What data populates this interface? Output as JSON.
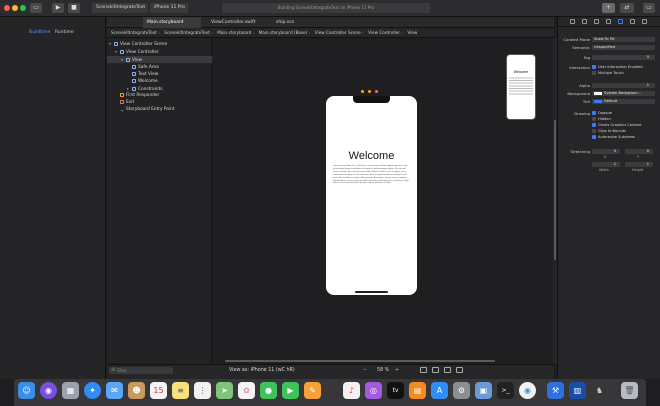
{
  "toolbar": {
    "scheme_target": "ScenekitIntegrateText",
    "device": "iPhone 11 Pro",
    "activity_status": "Building ScenekitIntegrateText on iPhone 11 Pro",
    "play_icon": "play-icon",
    "stop_icon": "stop-icon"
  },
  "navigator": {
    "tabs": [
      "Buildtime",
      "Runtime"
    ]
  },
  "tabs": [
    {
      "label": "Main.storyboard",
      "active": true
    },
    {
      "label": "ViewController.swift",
      "active": false
    },
    {
      "label": "ship.scn",
      "active": false
    }
  ],
  "breadcrumbs": [
    "ScenekitIntegrateText",
    "ScenekitIntegrateText",
    "Main.storyboard",
    "Main.storyboard (Base)",
    "View Controller Scene",
    "View Controller",
    "View"
  ],
  "outline": [
    {
      "label": "View Controller Scene",
      "indent": 0,
      "selected": false
    },
    {
      "label": "View Controller",
      "indent": 1,
      "selected": false
    },
    {
      "label": "View",
      "indent": 2,
      "selected": true
    },
    {
      "label": "Safe Area",
      "indent": 3,
      "selected": false
    },
    {
      "label": "Text View",
      "indent": 3,
      "selected": false
    },
    {
      "label": "Welcome",
      "indent": 3,
      "selected": false
    },
    {
      "label": "Constraints",
      "indent": 3,
      "selected": false
    },
    {
      "label": "First Responder",
      "indent": 1,
      "selected": false
    },
    {
      "label": "Exit",
      "indent": 1,
      "selected": false
    },
    {
      "label": "Storyboard Entry Point",
      "indent": 1,
      "selected": false
    }
  ],
  "canvas": {
    "welcome_title": "Welcome",
    "body_text": "Lorem ipsum dolor sit er elit lamet, consectetaur cillium adipisicing pecu, sed do eiusmod tempor incididunt ut labore et dolore magna aliqua. Ut enim ad minim veniam, quis nostrud exercitation ullamco laboris nisi ut aliquip ex ea commodo consequat. Duis aute irure dolor in reprehenderit in voluptate velit esse cillum dolore eu fugiat nulla pariatur. Excepteur sint occaecat cupidatat non proident, sunt in culpa qui officia deserunt mollit anim id est laborum. Nam liber te conscient to factor tum poen legum odioque civiuda.",
    "mini_title": "Welcome"
  },
  "bottombar": {
    "filter_placeholder": "Filter",
    "view_as": "View as: iPhone 11 (wC hR)",
    "zoom": "58 %"
  },
  "inspector": {
    "content_mode_label": "Content Mode",
    "content_mode": "Scale To Fill",
    "semantic_label": "Semantic",
    "semantic": "Unspecified",
    "tag_label": "Tag",
    "tag": "0",
    "interaction_label": "Interaction",
    "user_interaction": "User Interaction Enabled",
    "multiple_touch": "Multiple Touch",
    "alpha_label": "Alpha",
    "alpha": "1",
    "background_label": "Background",
    "background": "System Backgroun...",
    "tint_label": "Tint",
    "tint": "Default",
    "drawing_label": "Drawing",
    "opaque": "Opaque",
    "hidden": "Hidden",
    "clears": "Clears Graphics Context",
    "clips": "Clips to Bounds",
    "autoresize": "Autoresize Subviews",
    "stretching_label": "Stretching",
    "stretch_x": "0",
    "stretch_y": "0",
    "x_label": "X",
    "y_label": "Y",
    "stretch_w": "1",
    "stretch_h": "1",
    "width_label": "Width",
    "height_label": "Height"
  },
  "dock": [
    "finder-icon",
    "siri-icon",
    "launchpad-icon",
    "safari-icon",
    "mail-icon",
    "contacts-icon",
    "calendar-icon",
    "notes-icon",
    "reminders-icon",
    "maps-icon",
    "photos-icon",
    "messages-icon",
    "facetime-icon",
    "pages-icon",
    "music-icon",
    "podcasts-icon",
    "tv-icon",
    "books-icon",
    "appstore-icon",
    "system-preferences-icon",
    "preview-icon",
    "terminal-icon",
    "chrome-icon",
    "xcode-icon",
    "instruments-icon",
    "trash-icon"
  ],
  "colors": {
    "accent": "#3c7cf4",
    "selection": "#3a3a3d",
    "canvas_bg": "#1f1f21"
  }
}
